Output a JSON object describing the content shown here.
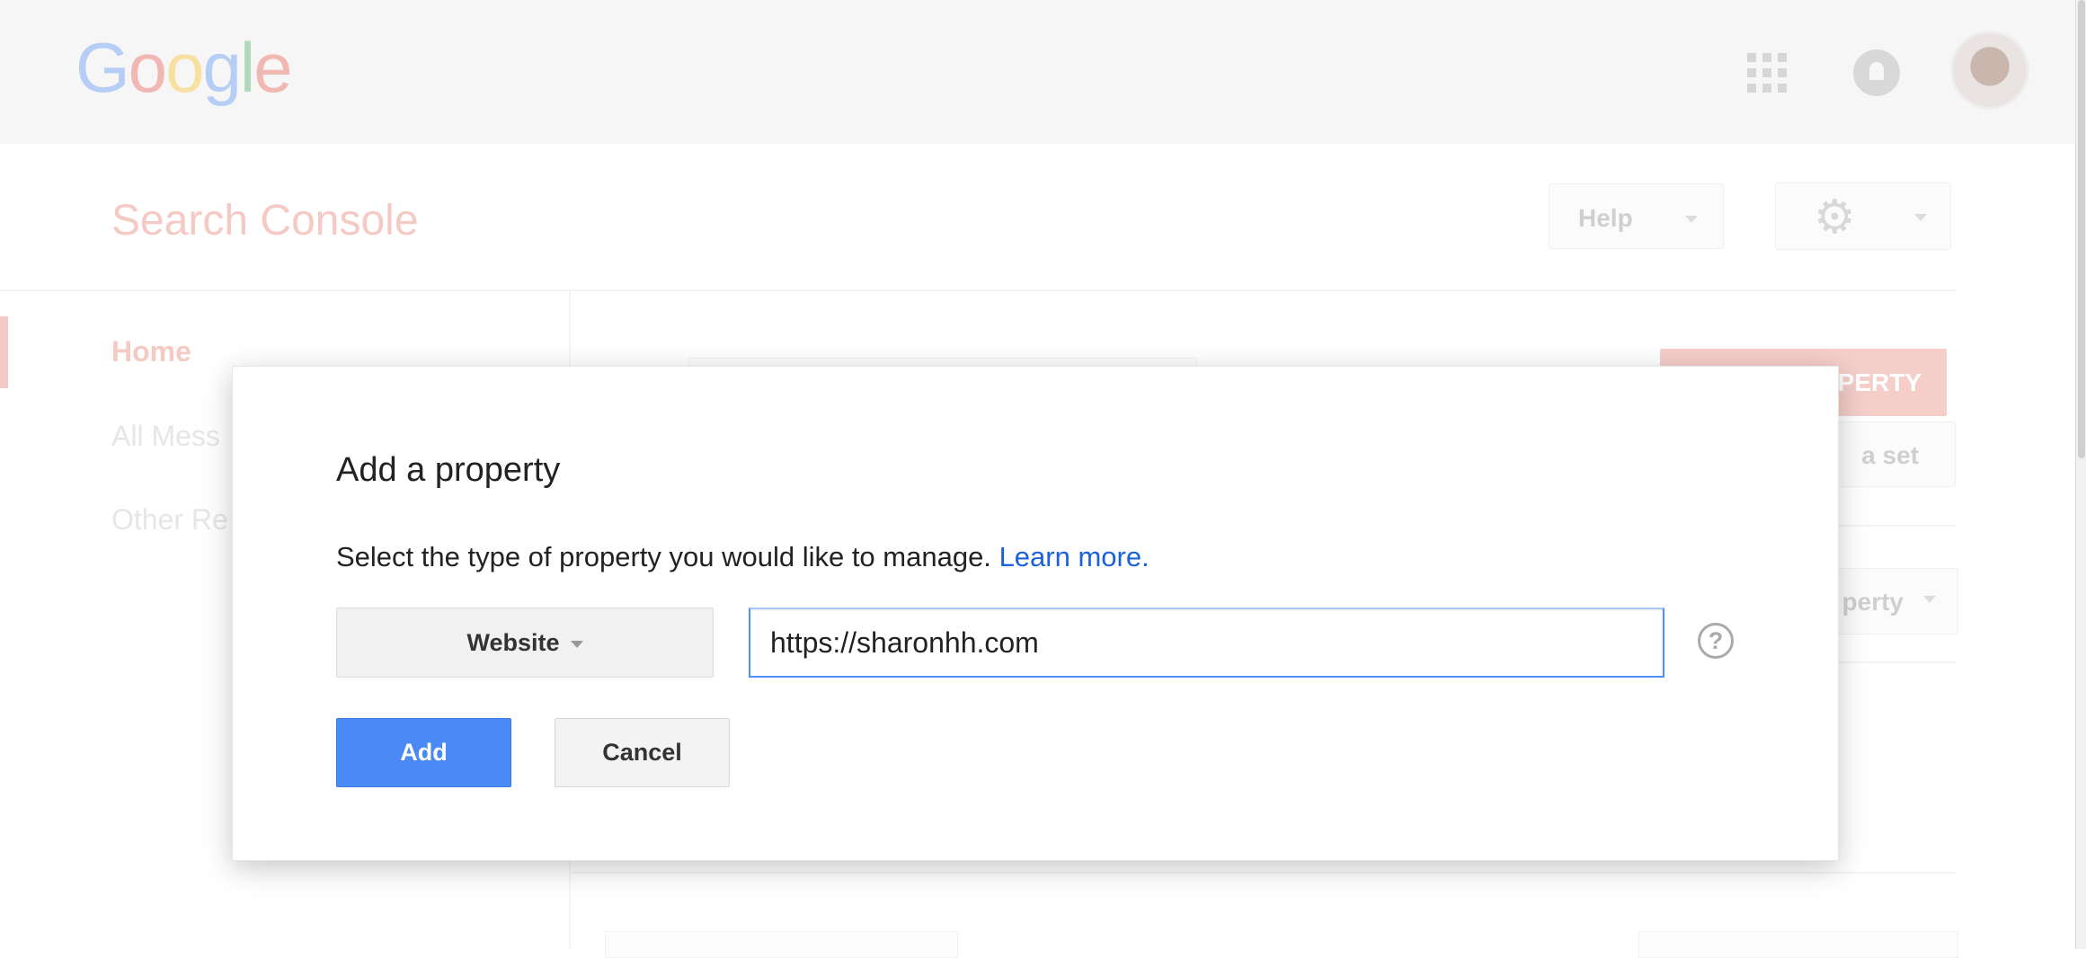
{
  "header": {
    "logo": "Google",
    "icons": [
      "apps-grid-icon",
      "notifications-bell-icon",
      "avatar"
    ]
  },
  "app": {
    "title": "Search Console",
    "help_label": "Help",
    "settings_icon": "gear-icon"
  },
  "sidebar": {
    "items": [
      {
        "label": "Home",
        "active": true
      },
      {
        "label": "All Mess"
      },
      {
        "label": "Other Re"
      }
    ]
  },
  "main": {
    "add_property_button": "PERTY",
    "add_set_button": "a set",
    "property_select": "perty"
  },
  "dialog": {
    "title": "Add a property",
    "description": "Select the type of property you would like to manage.",
    "learn_more": "Learn more.",
    "type_select": "Website",
    "url_value": "https://sharonhh.com",
    "help_icon": "question-circle-icon",
    "add_label": "Add",
    "cancel_label": "Cancel"
  },
  "colors": {
    "accent": "#4a8af4",
    "link": "#1a62d9",
    "brand_red_faded": "#f5c9c4"
  }
}
